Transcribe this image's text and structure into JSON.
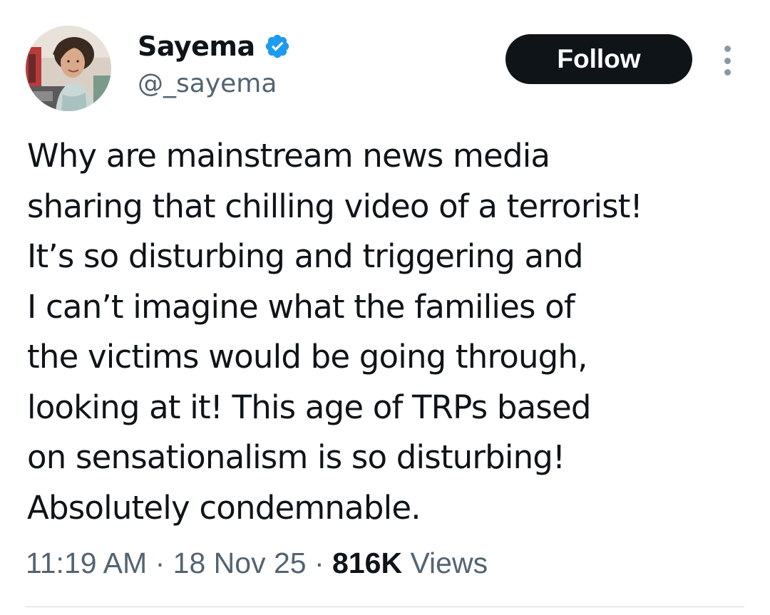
{
  "author": {
    "display_name": "Sayema",
    "handle": "@_sayema",
    "verified": true,
    "avatar_icon": "profile-photo"
  },
  "actions": {
    "follow_label": "Follow",
    "more_icon": "more-vertical-icon"
  },
  "tweet": {
    "lines": [
      "Why are mainstream news media",
      "sharing that chilling video of a terrorist!",
      "It’s so disturbing and triggering and",
      "I can’t imagine what the families of",
      "the victims would be going through,",
      "looking at it! This age of TRPs based",
      "on sensationalism is so disturbing!",
      "Absolutely condemnable."
    ]
  },
  "meta": {
    "time": "11:19 AM",
    "date": "18 Nov 25",
    "views_count": "816K",
    "views_label": "Views",
    "separator": "·"
  },
  "colors": {
    "follow_bg": "#0f1419",
    "verified_blue": "#1d9bf0",
    "secondary_text": "#536471",
    "primary_text": "#0f1419"
  }
}
